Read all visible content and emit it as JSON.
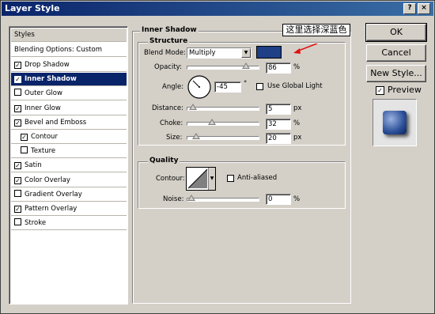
{
  "window": {
    "title": "Layer Style",
    "help_glyph": "?",
    "close_glyph": "×"
  },
  "sidebar": {
    "header": "Styles",
    "blending": "Blending Options: Custom",
    "items": [
      {
        "label": "Drop Shadow",
        "checked": true,
        "selected": false,
        "sub": false
      },
      {
        "label": "Inner Shadow",
        "checked": true,
        "selected": true,
        "sub": false
      },
      {
        "label": "Outer Glow",
        "checked": false,
        "selected": false,
        "sub": false
      },
      {
        "label": "Inner Glow",
        "checked": true,
        "selected": false,
        "sub": false
      },
      {
        "label": "Bevel and Emboss",
        "checked": true,
        "selected": false,
        "sub": false
      },
      {
        "label": "Contour",
        "checked": true,
        "selected": false,
        "sub": true
      },
      {
        "label": "Texture",
        "checked": false,
        "selected": false,
        "sub": true
      },
      {
        "label": "Satin",
        "checked": true,
        "selected": false,
        "sub": false
      },
      {
        "label": "Color Overlay",
        "checked": true,
        "selected": false,
        "sub": false
      },
      {
        "label": "Gradient Overlay",
        "checked": false,
        "selected": false,
        "sub": false
      },
      {
        "label": "Pattern Overlay",
        "checked": true,
        "selected": false,
        "sub": false
      },
      {
        "label": "Stroke",
        "checked": false,
        "selected": false,
        "sub": false
      }
    ]
  },
  "panel": {
    "title": "Inner Shadow",
    "annotation": "这里选择深蓝色",
    "structure": {
      "title": "Structure",
      "blend_mode_label": "Blend Mode:",
      "blend_mode_value": "Multiply",
      "shadow_color": "#1f3f86",
      "opacity_label": "Opacity:",
      "opacity_value": "86",
      "opacity_unit": "%",
      "opacity_level": 0.86,
      "angle_label": "Angle:",
      "angle_value": "-45",
      "angle_unit": "°",
      "global_light_label": "Use Global Light",
      "distance_label": "Distance:",
      "distance_value": "5",
      "distance_unit": "px",
      "distance_level": 0.02,
      "choke_label": "Choke:",
      "choke_value": "32",
      "choke_unit": "%",
      "choke_level": 0.32,
      "size_label": "Size:",
      "size_value": "20",
      "size_unit": "px",
      "size_level": 0.08
    },
    "quality": {
      "title": "Quality",
      "contour_label": "Contour:",
      "anti_aliased_label": "Anti-aliased",
      "noise_label": "Noise:",
      "noise_value": "0",
      "noise_unit": "%",
      "noise_level": 0
    }
  },
  "buttons": {
    "ok": "OK",
    "cancel": "Cancel",
    "new_style": "New Style...",
    "preview_label": "Preview"
  },
  "colors": {
    "accent": "#0a246a",
    "annotation_arrow": "#e01010"
  }
}
